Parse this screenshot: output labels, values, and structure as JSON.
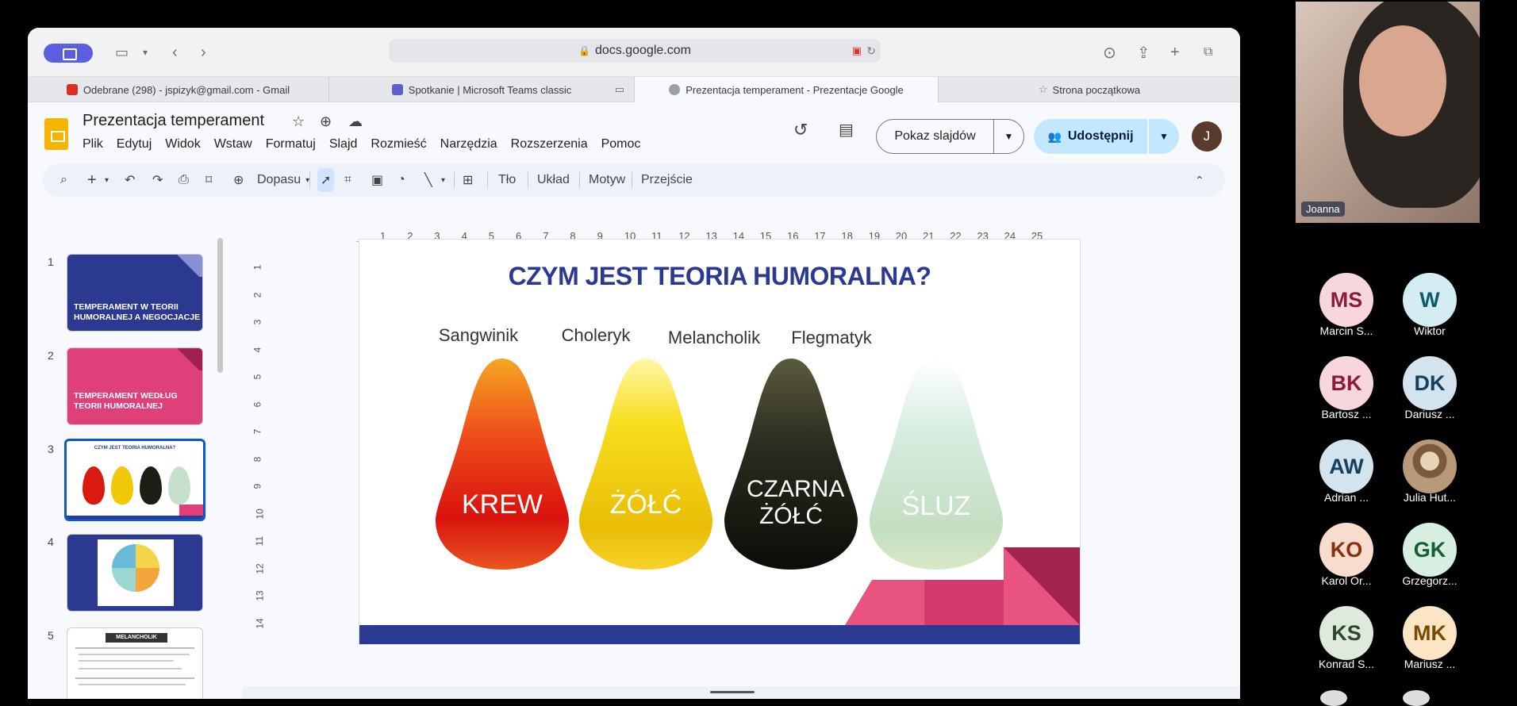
{
  "browser": {
    "url": "docs.google.com",
    "tabs": [
      {
        "label": "Odebrane (298) - jspizyk@gmail.com - Gmail",
        "icon": "gmail-icon",
        "color": "#d93025"
      },
      {
        "label": "Spotkanie | Microsoft Teams classic",
        "icon": "teams-icon",
        "color": "#5b5fc7"
      },
      {
        "label": "Prezentacja temperament - Prezentacje Google",
        "icon": "google-icon",
        "color": "#888"
      },
      {
        "label": "Strona początkowa",
        "icon": "star-icon",
        "color": "#777"
      }
    ]
  },
  "docs": {
    "title": "Prezentacja temperament",
    "menu": [
      "Plik",
      "Edytuj",
      "Widok",
      "Wstaw",
      "Formatuj",
      "Slajd",
      "Rozmieść",
      "Narzędzia",
      "Rozszerzenia",
      "Pomoc"
    ],
    "slideshow_label": "Pokaz slajdów",
    "share_label": "Udostępnij",
    "avatar_initial": "J",
    "toolbar": {
      "zoom": "Dopasu",
      "bg": "Tło",
      "layout": "Układ",
      "theme": "Motyw",
      "transition": "Przejście"
    }
  },
  "filmstrip": [
    {
      "num": "1",
      "text": "TEMPERAMENT W TEORII HUMORALNEJ A NEGOCJACJE"
    },
    {
      "num": "2",
      "text": "TEMPERAMENT WEDŁUG TEORII HUMORALNEJ"
    },
    {
      "num": "3",
      "text": ""
    },
    {
      "num": "4",
      "text": ""
    },
    {
      "num": "5",
      "text": "MELANCHOLIK"
    }
  ],
  "ruler": {
    "top": [
      "1",
      "2",
      "3",
      "4",
      "5",
      "6",
      "7",
      "8",
      "9",
      "10",
      "11",
      "12",
      "13",
      "14",
      "15",
      "16",
      "17",
      "18",
      "19",
      "20",
      "21",
      "22",
      "23",
      "24",
      "25"
    ],
    "left": [
      "1",
      "2",
      "3",
      "4",
      "5",
      "6",
      "7",
      "8",
      "9",
      "10",
      "11",
      "12",
      "13",
      "14"
    ]
  },
  "slide": {
    "title": "CZYM JEST TEORIA HUMORALNA?",
    "types": [
      {
        "label": "Sangwinik",
        "fluid": "KREW"
      },
      {
        "label": "Choleryk",
        "fluid": "ŻÓŁĆ"
      },
      {
        "label": "Melancholik",
        "fluid": "CZARNA ŻÓŁĆ"
      },
      {
        "label": "Flegmatyk",
        "fluid": "ŚLUZ"
      }
    ]
  },
  "meeting": {
    "speaker": "Joanna",
    "participants": [
      {
        "initials": "MS",
        "name": "Marcin S...",
        "bg": "#f7d6dc",
        "fg": "#8a1c3b"
      },
      {
        "initials": "W",
        "name": "Wiktor",
        "bg": "#d4ecf2",
        "fg": "#0e5a6b"
      },
      {
        "initials": "BK",
        "name": "Bartosz ...",
        "bg": "#f7d6dc",
        "fg": "#8a1c3b"
      },
      {
        "initials": "DK",
        "name": "Dariusz ...",
        "bg": "#d4e4ee",
        "fg": "#14405e"
      },
      {
        "initials": "AW",
        "name": "Adrian ...",
        "bg": "#d4e4ee",
        "fg": "#14405e"
      },
      {
        "initials": "",
        "name": "Julia Hut...",
        "bg": "#b89a7a",
        "fg": "#fff"
      },
      {
        "initials": "KO",
        "name": "Karol Or...",
        "bg": "#f8dccd",
        "fg": "#8a2e10"
      },
      {
        "initials": "GK",
        "name": "Grzegorz...",
        "bg": "#d6efe0",
        "fg": "#175c38"
      },
      {
        "initials": "KS",
        "name": "Konrad S...",
        "bg": "#dfe9dc",
        "fg": "#2c4a29"
      },
      {
        "initials": "MK",
        "name": "Mariusz ...",
        "bg": "#fbe5c4",
        "fg": "#7a4a00"
      }
    ]
  }
}
